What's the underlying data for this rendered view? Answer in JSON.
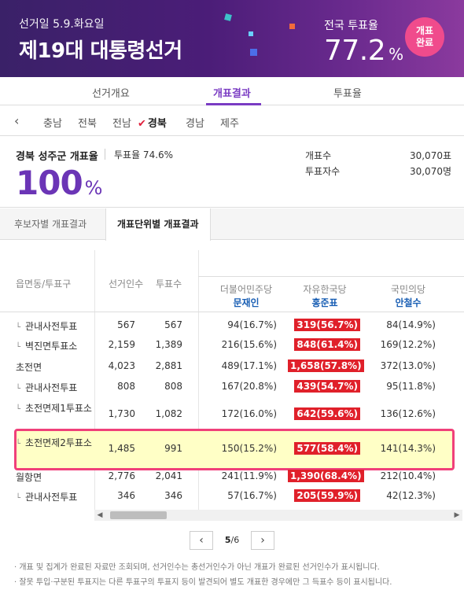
{
  "header": {
    "date": "선거일 5.9.화요일",
    "title": "제19대 대통령선거",
    "national_turnout_label": "전국 투표율",
    "national_turnout_value": "77.2",
    "national_turnout_unit": "%",
    "badge_line1": "개표",
    "badge_line2": "완료"
  },
  "main_tabs": [
    "선거개요",
    "개표결과",
    "투표율"
  ],
  "regions": {
    "back_icon": "chevron-left-icon",
    "items": [
      "충남",
      "전북",
      "전남",
      "경북",
      "경남",
      "제주"
    ],
    "active": "경북"
  },
  "summary": {
    "name": "경북 성주군 개표율",
    "turnout": "투표율 74.6%",
    "progress_value": "100",
    "progress_unit": "%",
    "counted_label": "개표수",
    "counted_value": "30,070표",
    "voters_label": "투표자수",
    "voters_value": "30,070명"
  },
  "sub_tabs": [
    "후보자별 개표결과",
    "개표단위별 개표결과"
  ],
  "table": {
    "headers": {
      "area": "읍면동/투표구",
      "electors": "선거인수",
      "voters": "투표수"
    },
    "candidates": [
      {
        "party": "더불어민주당",
        "name": "문재인"
      },
      {
        "party": "자유한국당",
        "name": "홍준표"
      },
      {
        "party": "국민의당",
        "name": "안철수"
      }
    ],
    "rows": [
      {
        "name": "관내사전투표",
        "sub": true,
        "electors": "567",
        "voters": "567",
        "c1": "94(16.7%)",
        "c2": "319(56.7%)",
        "c3": "84(14.9%)"
      },
      {
        "name": "벽진면투표소",
        "sub": true,
        "electors": "2,159",
        "voters": "1,389",
        "c1": "216(15.6%)",
        "c2": "848(61.4%)",
        "c3": "169(12.2%)"
      },
      {
        "name": "초전면",
        "sub": false,
        "electors": "4,023",
        "voters": "2,881",
        "c1": "489(17.1%)",
        "c2": "1,658(57.8%)",
        "c3": "372(13.0%)"
      },
      {
        "name": "관내사전투표",
        "sub": true,
        "electors": "808",
        "voters": "808",
        "c1": "167(20.8%)",
        "c2": "439(54.7%)",
        "c3": "95(11.8%)"
      },
      {
        "name": "초전면제1투표소",
        "sub": true,
        "electors": "1,730",
        "voters": "1,082",
        "c1": "172(16.0%)",
        "c2": "642(59.6%)",
        "c3": "136(12.6%)"
      },
      {
        "name": "초전면제2투표소",
        "sub": true,
        "electors": "1,485",
        "voters": "991",
        "c1": "150(15.2%)",
        "c2": "577(58.4%)",
        "c3": "141(14.3%)"
      },
      {
        "name": "월항면",
        "sub": false,
        "electors": "2,776",
        "voters": "2,041",
        "c1": "241(11.9%)",
        "c2": "1,390(68.4%)",
        "c3": "212(10.4%)"
      },
      {
        "name": "관내사전투표",
        "sub": true,
        "electors": "346",
        "voters": "346",
        "c1": "57(16.7%)",
        "c2": "205(59.9%)",
        "c3": "42(12.3%)"
      }
    ]
  },
  "pager": {
    "current": "5",
    "total": "6",
    "prev_icon": "chevron-left-icon",
    "next_icon": "chevron-right-icon"
  },
  "notes": [
    "· 개표 및 집계가 완료된 자료만 조회되며, 선거인수는 총선거인수가 아닌 개표가 완료된 선거인수가 표시됩니다.",
    "· 잘못 투입·구분된 투표지는 다른 투표구의 투표지 등이 발견되어 별도 개표한 경우에만 그 득표수 등이 표시됩니다."
  ],
  "colors": {
    "header_bg": "#4b1d78",
    "accent_purple": "#7a3cc3",
    "badge_pink": "#f04b8c",
    "winner_red": "#e0202a",
    "highlight_yellow": "#ffffc6",
    "highlight_border": "#f0407a"
  }
}
